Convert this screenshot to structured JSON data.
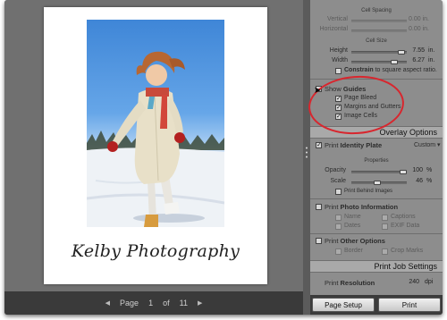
{
  "canvas": {
    "signature": "Kelby Photography",
    "nav": {
      "page_label": "Page",
      "current": "1",
      "of_label": "of",
      "total": "11",
      "prev_icon": "triangle-left",
      "next_icon": "triangle-right"
    }
  },
  "panel": {
    "cell_spacing": {
      "heading": "Cell Spacing",
      "vertical_label": "Vertical",
      "vertical_value": "0.00 in.",
      "horizontal_label": "Horizontal",
      "horizontal_value": "0.00 in."
    },
    "cell_size": {
      "heading": "Cell Size",
      "height_label": "Height",
      "height_value": "7.55",
      "height_unit": "in.",
      "width_label": "Width",
      "width_value": "6.27",
      "width_unit": "in.",
      "constrain_bold": "Constrain",
      "constrain_rest": " to square aspect ratio."
    },
    "guides": {
      "label_prefix": "Show ",
      "label_bold": "Guides",
      "page_bleed": "Page Bleed",
      "margins": "Margins and Gutters",
      "image_cells": "Image Cells"
    },
    "overlay_title": "Overlay Options",
    "identity": {
      "label_prefix": "Print ",
      "label_bold": "Identity Plate",
      "dropdown": "Custom ▾"
    },
    "properties": {
      "heading": "Properties",
      "opacity_label": "Opacity",
      "opacity_value": "100",
      "opacity_unit": "%",
      "scale_label": "Scale",
      "scale_value": "46",
      "scale_unit": "%",
      "behind_images": "Print Behind Images"
    },
    "photo_info": {
      "label_prefix": "Print ",
      "label_bold": "Photo Information",
      "name": "Name",
      "captions": "Captions",
      "dates": "Dates",
      "exif": "EXIF Data"
    },
    "other": {
      "label_prefix": "Print ",
      "label_bold": "Other Options",
      "border": "Border",
      "crop_marks": "Crop Marks"
    },
    "print_job_title": "Print Job Settings",
    "resolution": {
      "label_prefix": "Print ",
      "label_bold": "Resolution",
      "value": "240",
      "unit": "dpi"
    },
    "buttons": {
      "page_setup": "Page Setup",
      "print": "Print"
    }
  },
  "state": {
    "opacity_fraction": 1.0,
    "scale_fraction": 0.46
  },
  "colors": {
    "annotation_oval": "#d8262e",
    "panel_bg": "#8d8d8d",
    "canvas_bg": "#707070"
  }
}
